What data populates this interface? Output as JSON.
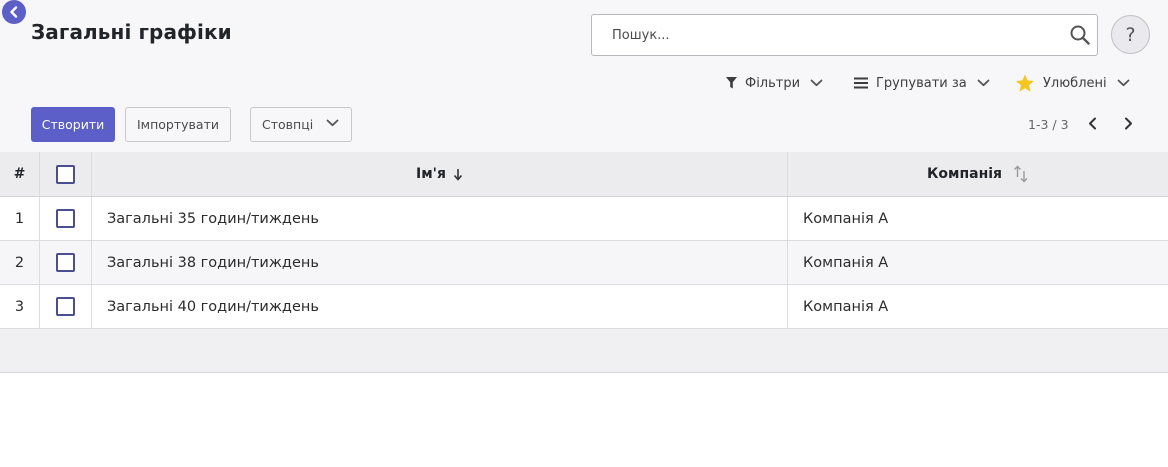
{
  "header": {
    "title": "Загальні графіки",
    "back_icon": "chevron-left-circle-icon"
  },
  "search": {
    "placeholder": "Пошук...",
    "value": "",
    "icon": "search-icon"
  },
  "help": {
    "label": "?"
  },
  "search_panel": {
    "filters_label": "Фільтри",
    "group_by_label": "Групувати за",
    "favorites_label": "Улюблені",
    "favorites_star_color": "#f3c623"
  },
  "actions": {
    "create_label": "Створити",
    "import_label": "Імпортувати",
    "columns_label": "Стовпці"
  },
  "pager": {
    "value": "1-3 / 3"
  },
  "colors": {
    "primary": "#5b5fc7",
    "control_panel_bg": "#f7f7f9"
  },
  "table": {
    "columns": {
      "number": "#",
      "name": "Ім'я",
      "company": "Компанія"
    },
    "rows": [
      {
        "num": "1",
        "name": "Загальні 35 годин/тиждень",
        "company": "Компанія А"
      },
      {
        "num": "2",
        "name": "Загальні 38 годин/тиждень",
        "company": "Компанія А"
      },
      {
        "num": "3",
        "name": "Загальні 40 годин/тиждень",
        "company": "Компанія А"
      }
    ]
  }
}
